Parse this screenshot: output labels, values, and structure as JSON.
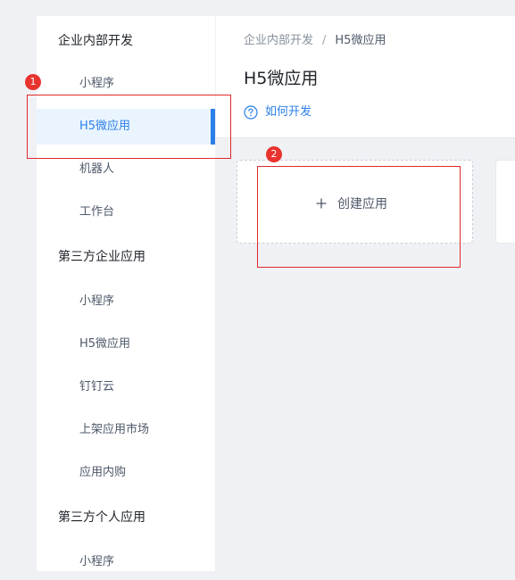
{
  "sidebar": {
    "groups": [
      {
        "title": "企业内部开发",
        "items": [
          "小程序",
          "H5微应用",
          "机器人",
          "工作台"
        ]
      },
      {
        "title": "第三方企业应用",
        "items": [
          "小程序",
          "H5微应用",
          "钉钉云",
          "上架应用市场",
          "应用内购"
        ]
      },
      {
        "title": "第三方个人应用",
        "items": [
          "小程序"
        ]
      }
    ],
    "active_item": "H5微应用",
    "accent_color": "#2b7fe8"
  },
  "breadcrumb": {
    "parent": "企业内部开发",
    "separator": "/",
    "current": "H5微应用"
  },
  "page": {
    "title": "H5微应用",
    "help_link": "如何开发",
    "help_icon": "question-circle-icon"
  },
  "create_card": {
    "label": "创建应用",
    "icon": "plus-icon"
  },
  "annotations": {
    "badge_1": "1",
    "badge_2": "2",
    "color": "#e02a2a"
  }
}
